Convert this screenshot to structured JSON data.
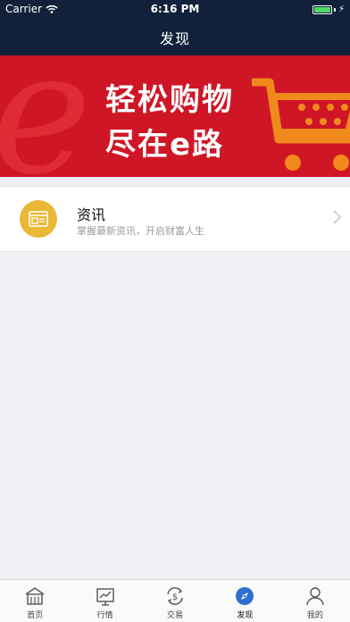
{
  "status": {
    "carrier": "Carrier",
    "time": "6:16 PM"
  },
  "nav": {
    "title": "发现"
  },
  "banner": {
    "line1": "轻松购物",
    "line2": "尽在e路"
  },
  "card": {
    "title": "资讯",
    "subtitle": "掌握最新资讯，开启财富人生"
  },
  "tabs": [
    {
      "label": "首页",
      "icon": "home-icon"
    },
    {
      "label": "行情",
      "icon": "chart-icon"
    },
    {
      "label": "交易",
      "icon": "dollar-exchange-icon"
    },
    {
      "label": "发现",
      "icon": "compass-icon",
      "active": true
    },
    {
      "label": "我的",
      "icon": "person-icon"
    }
  ],
  "colors": {
    "topbar": "#12213a",
    "banner": "#cf1626",
    "accent": "#2f6fcf",
    "news_icon_bg": "#e8b836"
  }
}
